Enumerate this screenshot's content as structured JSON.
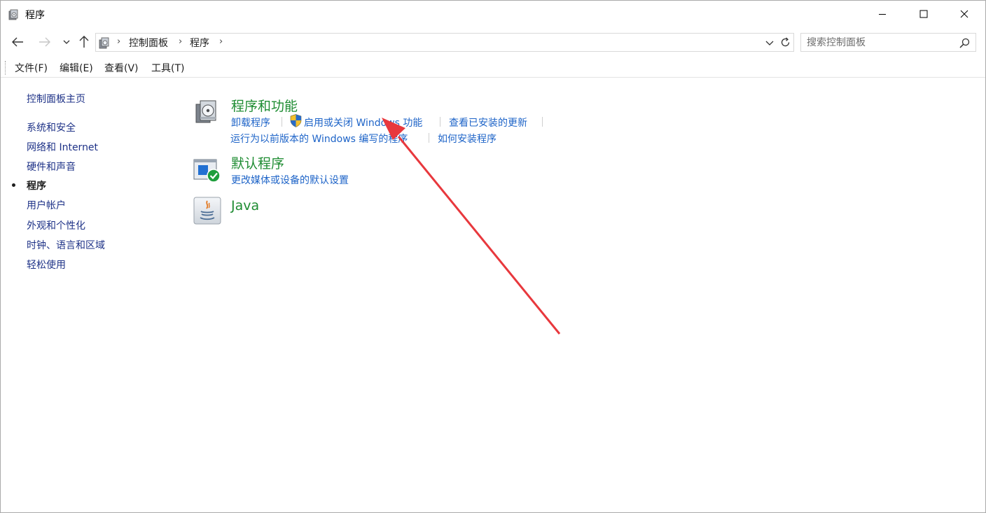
{
  "window": {
    "title": "程序"
  },
  "address": {
    "crumbs": [
      "控制面板",
      "程序"
    ]
  },
  "search": {
    "placeholder": "搜索控制面板"
  },
  "menu": {
    "items": [
      "文件(F)",
      "编辑(E)",
      "查看(V)",
      "工具(T)"
    ]
  },
  "leftnav": {
    "home": "控制面板主页",
    "items": [
      "系统和安全",
      "网络和 Internet",
      "硬件和声音",
      "程序",
      "用户帐户",
      "外观和个性化",
      "时钟、语言和区域",
      "轻松使用"
    ],
    "current_index": 3
  },
  "categories": [
    {
      "title": "程序和功能",
      "icon": "programs-features-icon",
      "links": [
        "卸载程序",
        "启用或关闭 Windows 功能",
        "查看已安装的更新",
        "运行为以前版本的 Windows 编写的程序",
        "如何安装程序"
      ]
    },
    {
      "title": "默认程序",
      "icon": "default-programs-icon",
      "links": [
        "更改媒体或设备的默认设置"
      ]
    },
    {
      "title": "Java",
      "icon": "java-icon",
      "links": []
    }
  ],
  "colors": {
    "category_title": "#1e8c32",
    "link": "#1e64c8",
    "nav_link": "#1e3287",
    "annotation_arrow": "#e8383d"
  }
}
